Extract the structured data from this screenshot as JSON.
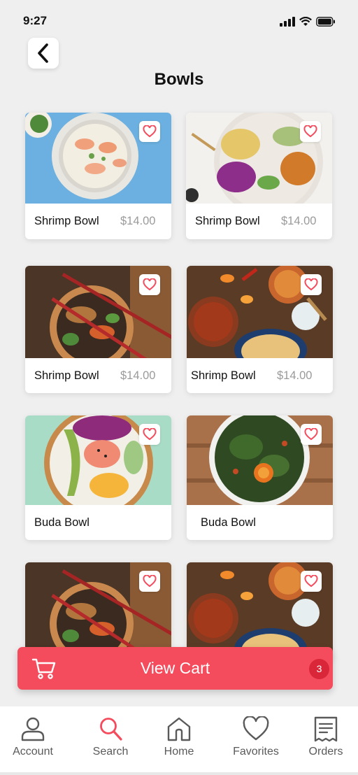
{
  "status": {
    "time": "9:27"
  },
  "header": {
    "title": "Bowls"
  },
  "products": [
    {
      "name": "Shrimp Bowl",
      "price": "$14.00"
    },
    {
      "name": "Shrimp Bowl",
      "price": "$14.00"
    },
    {
      "name": "Shrimp Bowl",
      "price": "$14.00"
    },
    {
      "name": "Shrimp Bowl",
      "price": "$14.00"
    },
    {
      "name": "Buda Bowl"
    },
    {
      "name": "Buda Bowl"
    }
  ],
  "cart": {
    "label": "View Cart",
    "count": "3"
  },
  "tabbar": {
    "items": [
      {
        "label": "Account",
        "icon": "person-icon"
      },
      {
        "label": "Search",
        "icon": "search-icon"
      },
      {
        "label": "Home",
        "icon": "home-icon"
      },
      {
        "label": "Favorites",
        "icon": "heart-icon"
      },
      {
        "label": "Orders",
        "icon": "receipt-icon"
      }
    ],
    "active": "Search"
  },
  "colors": {
    "accent": "#f44b5d",
    "badge": "#d92638",
    "background": "#efefef"
  }
}
